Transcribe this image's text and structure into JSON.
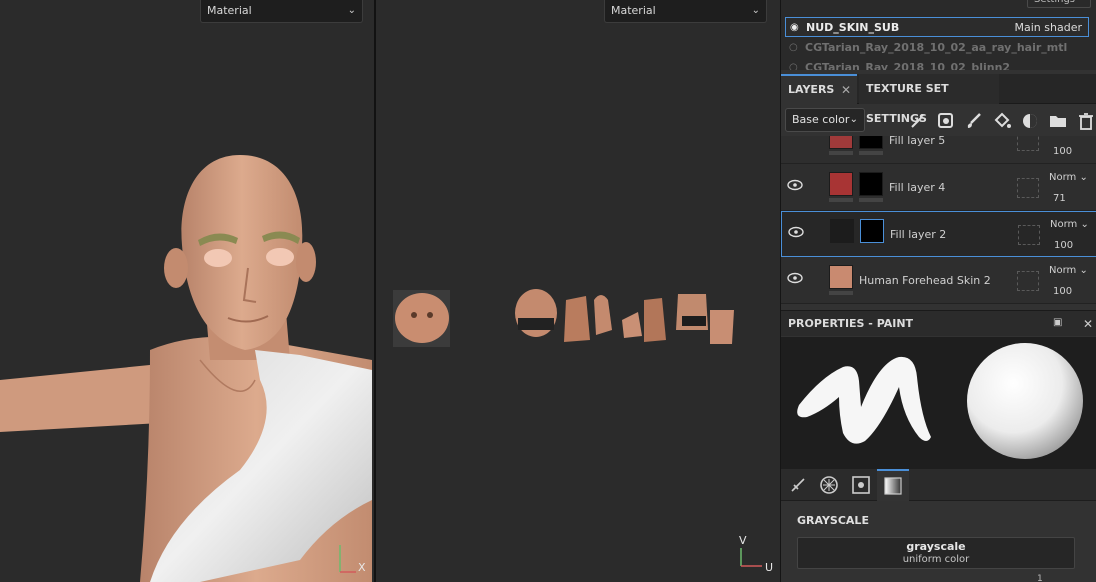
{
  "viewport3d": {
    "channel_select": "Material",
    "axis_x": "X"
  },
  "viewport2d": {
    "channel_select": "Material",
    "axis_y": "V",
    "axis_x": "U"
  },
  "shader_panel": {
    "settings_label": "Settings",
    "rows": [
      {
        "name": "NUD_SKIN_SUB",
        "right": "Main shader",
        "selected": true
      },
      {
        "name": "CGTarian_Ray_2018_10_02_aa_ray_hair_mtl",
        "right": ""
      },
      {
        "name": "CGTarian_Ray_2018_10_02_blinn2",
        "right": ""
      }
    ]
  },
  "tabs": {
    "layers": "LAYERS",
    "texture_set": "TEXTURE SET SETTINGS"
  },
  "layer_toolbar": {
    "channel": "Base color"
  },
  "layers": [
    {
      "name": "Fill layer 5",
      "blend": "",
      "opacity": "100",
      "thumb_color": "#a03a3a"
    },
    {
      "name": "Fill layer 4",
      "blend": "Norm",
      "opacity": "71",
      "thumb_color": "#a83434"
    },
    {
      "name": "Fill layer 2",
      "blend": "Norm",
      "opacity": "100",
      "thumb_color": "#1c1c1c",
      "selected": true
    },
    {
      "name": "Human Forehead Skin 2",
      "blend": "Norm",
      "opacity": "100",
      "thumb_color": "#c98a70"
    }
  ],
  "properties": {
    "title": "PROPERTIES - PAINT",
    "grayscale_title": "GRAYSCALE",
    "grayscale_name": "grayscale",
    "grayscale_sub": "uniform color",
    "grayscale_value": "1"
  },
  "colors": {
    "accent": "#4a8fd8",
    "skin": "#d39b7c",
    "cloth": "#e2e2e2"
  }
}
